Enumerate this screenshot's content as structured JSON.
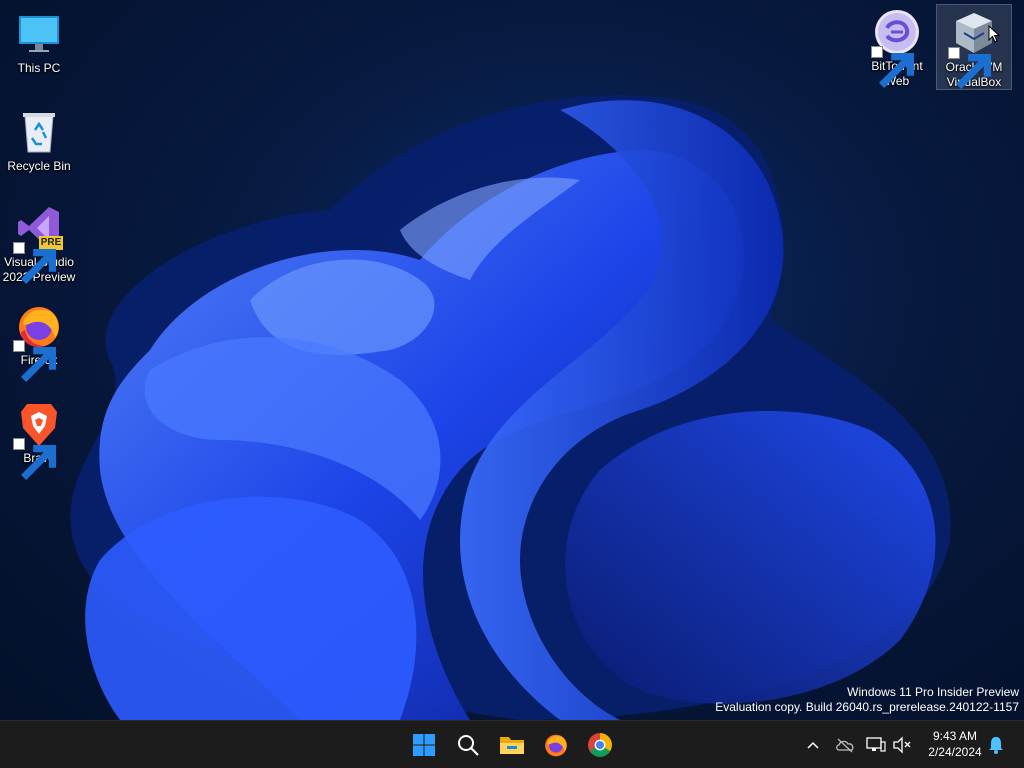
{
  "desktop": {
    "icons_left": [
      {
        "name": "this-pc",
        "label": "This PC"
      },
      {
        "name": "recycle-bin",
        "label": "Recycle Bin"
      },
      {
        "name": "visual-studio",
        "label": "Visual Studio\n2022 Preview",
        "badge": "PRE"
      },
      {
        "name": "firefox",
        "label": "Firefox"
      },
      {
        "name": "brave",
        "label": "Brave"
      }
    ],
    "icons_right": [
      {
        "name": "bittorrent-web",
        "label": "BitTorrent\nWeb"
      },
      {
        "name": "virtualbox",
        "label": "Oracle VM\nVirtualBox",
        "selected": true
      }
    ]
  },
  "watermark": {
    "line1": "Windows 11 Pro Insider Preview",
    "line2": "Evaluation copy. Build 26040.rs_prerelease.240122-1157"
  },
  "taskbar": {
    "pinned": [
      "start-icon",
      "search-icon",
      "file-explorer-icon",
      "firefox-icon",
      "chrome-icon"
    ],
    "tray": [
      "chevron-up-icon",
      "onedrive-icon",
      "network-icon",
      "volume-muted-icon"
    ],
    "time": "9:43 AM",
    "date": "2/24/2024",
    "notification_icon": "bell-icon"
  },
  "colors": {
    "accent": "#1f5bff",
    "taskbar_bg": "#1c1c1c",
    "start_blue": "#2f9cff"
  }
}
